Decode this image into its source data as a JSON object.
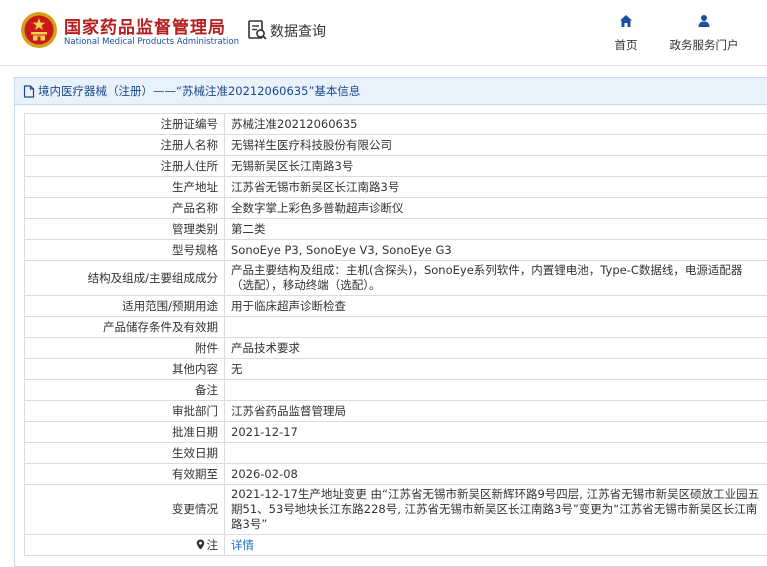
{
  "header": {
    "brand_cn": "国家药品监督管理局",
    "brand_en": "National Medical Products Administration",
    "query_label": "数据查询",
    "nav": [
      {
        "label": "首页",
        "icon": "home-icon"
      },
      {
        "label": "政务服务门户",
        "icon": "user-icon"
      }
    ]
  },
  "breadcrumb": {
    "text": "境内医疗器械（注册）——“苏械注准20212060635”基本信息"
  },
  "rows": [
    {
      "label": "注册证编号",
      "value": "苏械注准20212060635"
    },
    {
      "label": "注册人名称",
      "value": "无锡祥生医疗科技股份有限公司"
    },
    {
      "label": "注册人住所",
      "value": "无锡新吴区长江南路3号"
    },
    {
      "label": "生产地址",
      "value": "江苏省无锡市新吴区长江南路3号"
    },
    {
      "label": "产品名称",
      "value": "全数字掌上彩色多普勒超声诊断仪"
    },
    {
      "label": "管理类别",
      "value": "第二类"
    },
    {
      "label": "型号规格",
      "value": "SonoEye P3, SonoEye V3, SonoEye G3"
    },
    {
      "label": "结构及组成/主要组成成分",
      "value": "产品主要结构及组成：主机(含探头)，SonoEye系列软件，内置锂电池，Type-C数据线，电源适配器（选配），移动终端（选配）。"
    },
    {
      "label": "适用范围/预期用途",
      "value": "用于临床超声诊断检查"
    },
    {
      "label": "产品储存条件及有效期",
      "value": ""
    },
    {
      "label": "附件",
      "value": "产品技术要求"
    },
    {
      "label": "其他内容",
      "value": "无"
    },
    {
      "label": "备注",
      "value": ""
    },
    {
      "label": "审批部门",
      "value": "江苏省药品监督管理局"
    },
    {
      "label": "批准日期",
      "value": "2021-12-17"
    },
    {
      "label": "生效日期",
      "value": ""
    },
    {
      "label": "有效期至",
      "value": "2026-02-08"
    },
    {
      "label": "变更情况",
      "value": "2021-12-17生产地址变更 由“江苏省无锡市新吴区新辉环路9号四层, 江苏省无锡市新吴区硕放工业园五期51、53号地块长江东路228号, 江苏省无锡市新吴区长江南路3号”变更为“江苏省无锡市新吴区长江南路3号”"
    }
  ],
  "note_row": {
    "label": "注",
    "link": "详情"
  },
  "colors": {
    "brand_red": "#b51e1e",
    "brand_blue": "#1a4fa0",
    "link_blue": "#1a6ec4",
    "crumb_bg": "#e9f1fb"
  }
}
